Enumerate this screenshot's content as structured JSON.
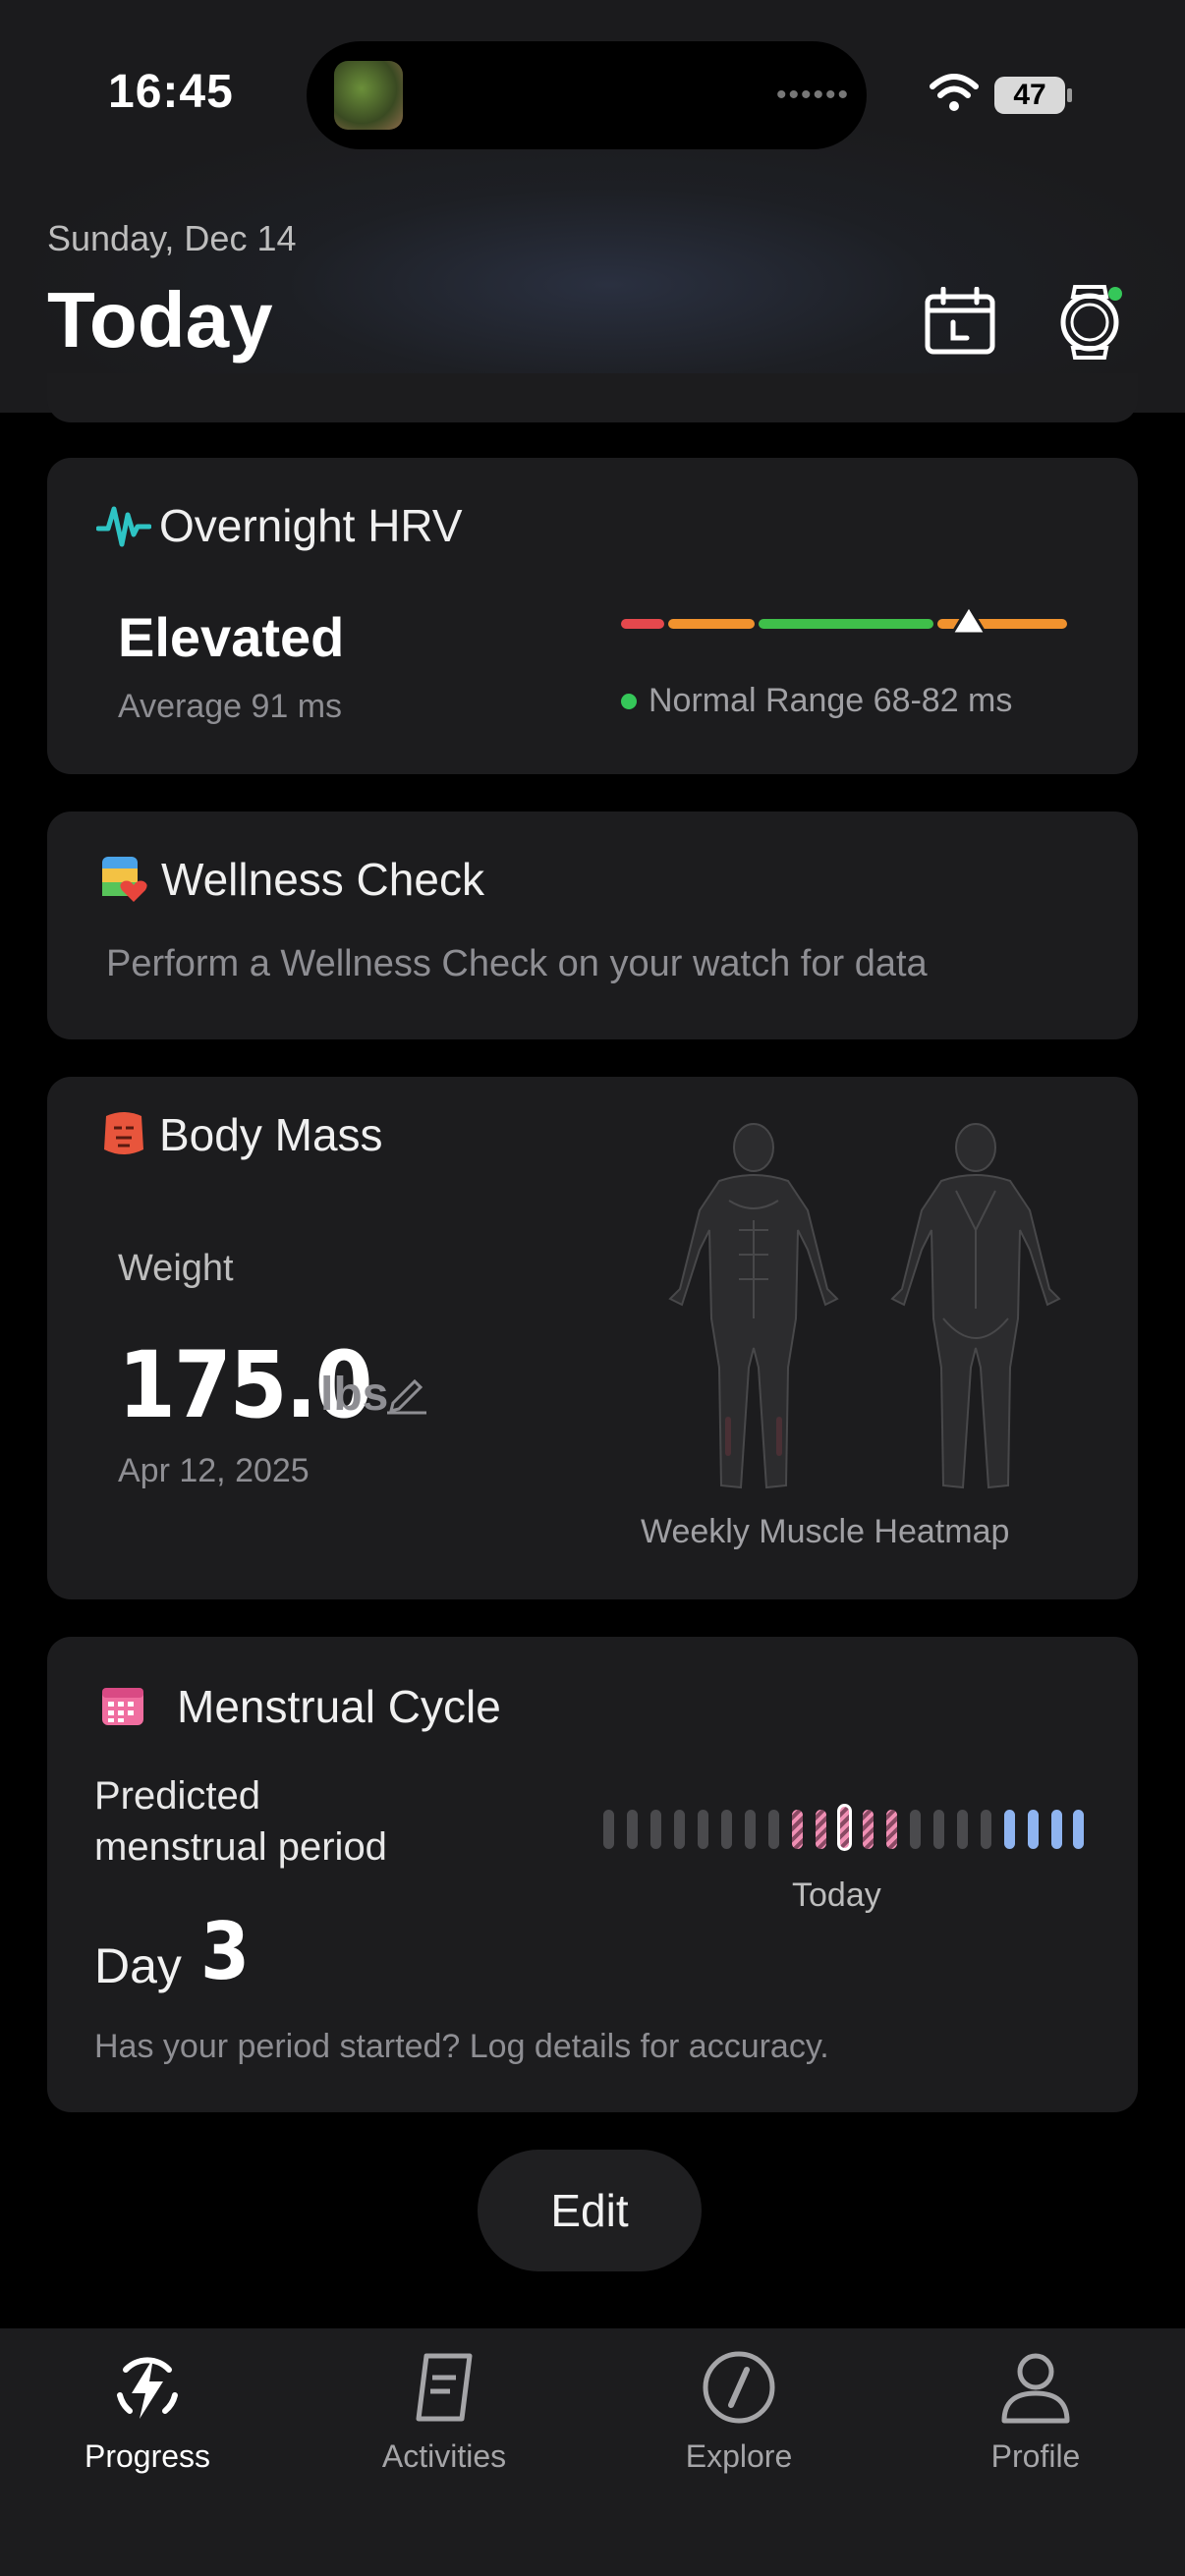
{
  "status_bar": {
    "time": "16:45",
    "battery": "47"
  },
  "header": {
    "date": "Sunday, Dec 14",
    "title": "Today"
  },
  "hrv": {
    "title": "Overnight HRV",
    "status": "Elevated",
    "average": "Average 91 ms",
    "normal_range": "Normal Range 68-82 ms",
    "colors": {
      "red": "#e5484d",
      "orange": "#f0922e",
      "green": "#3fbf4a",
      "icon": "#2ec4c4"
    }
  },
  "wellness": {
    "title": "Wellness Check",
    "message": "Perform a Wellness Check on your watch for data"
  },
  "body_mass": {
    "title": "Body Mass",
    "label": "Weight",
    "value": "175.0",
    "unit": "lbs",
    "date": "Apr 12, 2025",
    "heatmap_label": "Weekly Muscle Heatmap"
  },
  "menstrual": {
    "title": "Menstrual Cycle",
    "line1": "Predicted",
    "line2": "menstrual period",
    "day_label": "Day",
    "day_value": "3",
    "today_label": "Today",
    "hint": "Has your period started? Log details for accuracy.",
    "bar_colors": {
      "neutral": "#4a4a4d",
      "period": "#f08fb4",
      "fertile": "#8fb4f0"
    }
  },
  "edit_label": "Edit",
  "tabs": [
    {
      "label": "Progress",
      "icon": "bolt-icon",
      "active": true
    },
    {
      "label": "Activities",
      "icon": "note-icon",
      "active": false
    },
    {
      "label": "Explore",
      "icon": "compass-icon",
      "active": false
    },
    {
      "label": "Profile",
      "icon": "person-icon",
      "active": false
    }
  ]
}
